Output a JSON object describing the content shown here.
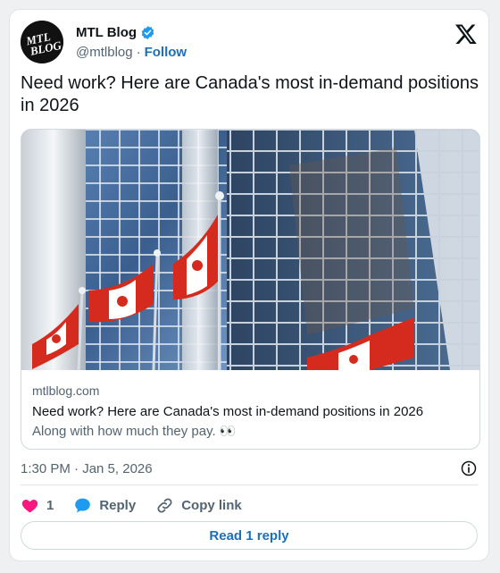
{
  "author": {
    "name": "MTL Blog",
    "handle": "@mtlblog",
    "separator": "·",
    "follow_label": "Follow",
    "avatar_line1": "MTL",
    "avatar_line2": "BLOG"
  },
  "tweet": {
    "text": "Need work? Here are Canada's most in-demand positions in 2026",
    "timestamp": "1:30 PM · Jan 5, 2026"
  },
  "link_card": {
    "domain": "mtlblog.com",
    "title": "Need work? Here are Canada's most in-demand positions in 2026",
    "description": "Along with how much they pay. 👀"
  },
  "actions": {
    "like_count": "1",
    "reply_label": "Reply",
    "copy_label": "Copy link"
  },
  "read_replies_label": "Read 1 reply",
  "colors": {
    "accent": "#1d6fb8",
    "like": "#f91880",
    "verified": "#1d9bf0",
    "reply_bubble": "#1d9bf0"
  }
}
